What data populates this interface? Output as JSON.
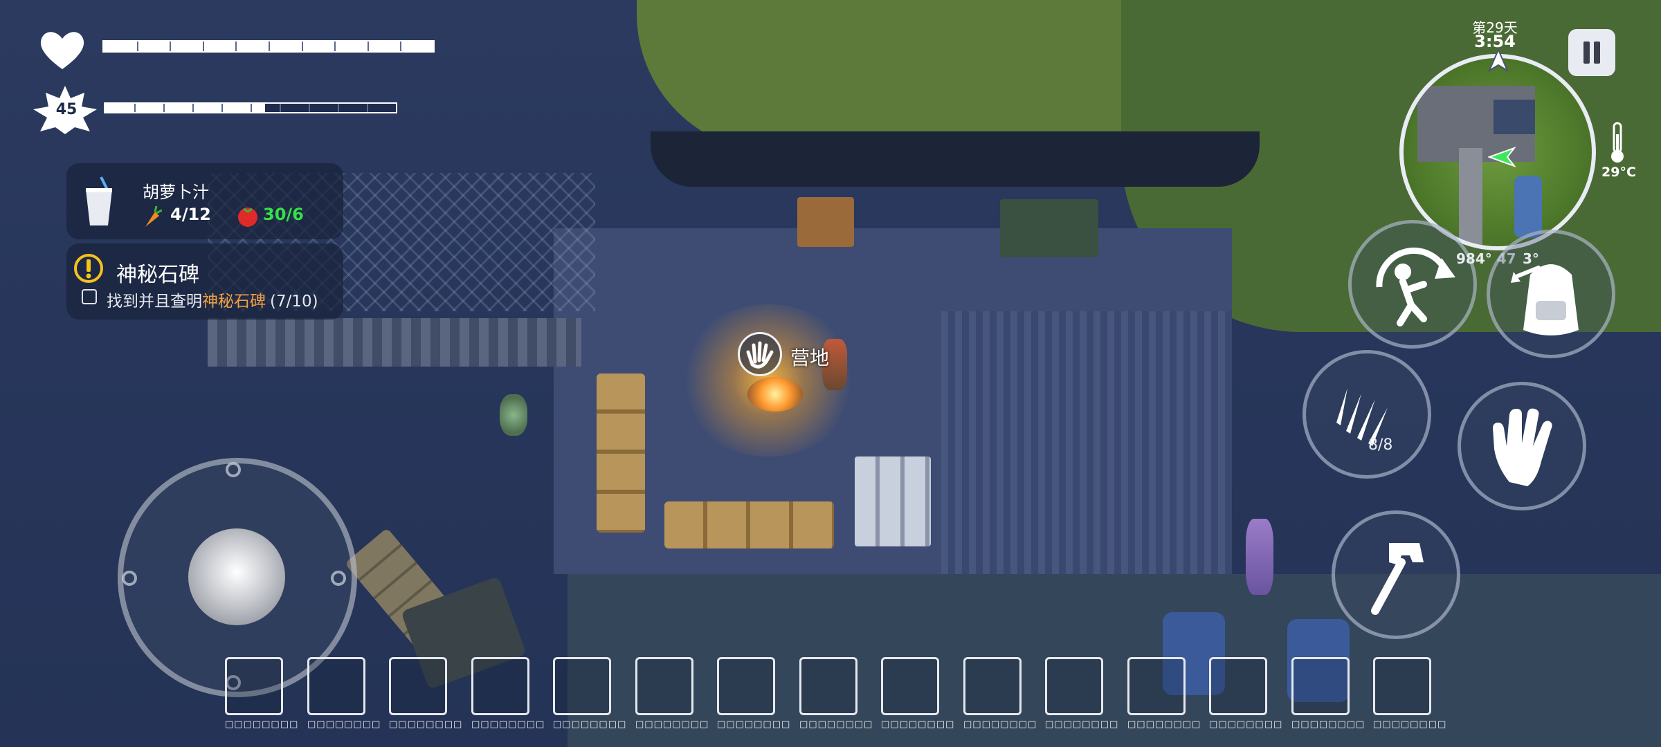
{
  "player": {
    "health_icon": "heart-icon",
    "level": "45",
    "level_icon": "star-badge-icon",
    "health_fraction": 1.0,
    "stamina_fraction": 0.55
  },
  "equipped_item": {
    "name": "胡萝卜汁",
    "icon": "juice-cup-icon",
    "carrot_value": "4/12",
    "carrot_icon": "carrot-icon",
    "tomato_value": "30/6",
    "tomato_icon": "tomato-icon",
    "tomato_color": "#35e04a"
  },
  "quest": {
    "icon": "exclamation-icon",
    "title": "神秘石碑",
    "objective_prefix": "找到并且查明",
    "objective_target": "神秘石碑",
    "objective_count": "(7/10)",
    "target_color": "#f0a040"
  },
  "world": {
    "interaction_icon": "hand-icon",
    "interaction_label": "营地"
  },
  "status": {
    "day": "第29天",
    "time": "3:54",
    "temperature": "29°C",
    "temperature_icon": "thermometer-icon",
    "pause_icon": "pause-icon",
    "compass_icon": "compass-arrow-icon"
  },
  "minimap": {
    "player_marker_icon": "player-arrow-icon"
  },
  "actions": {
    "dodge_icon": "roll-dodge-icon",
    "dodge_coords": "984° 47",
    "backpack_icon": "backpack-icon",
    "backpack_coords": "3°",
    "throw_icon": "throwing-knives-icon",
    "throw_count": "8/8",
    "grab_icon": "hand-icon",
    "attack_icon": "hammer-icon"
  },
  "joystick": {
    "icon": "joystick-knob-icon"
  },
  "hotbar": {
    "slots": [
      {
        "label": "□□□□□□□□"
      },
      {
        "label": "□□□□□□□□"
      },
      {
        "label": "□□□□□□□□"
      },
      {
        "label": "□□□□□□□□"
      },
      {
        "label": "□□□□□□□□"
      },
      {
        "label": "□□□□□□□□"
      },
      {
        "label": "□□□□□□□□"
      },
      {
        "label": "□□□□□□□□"
      },
      {
        "label": "□□□□□□□□"
      },
      {
        "label": "□□□□□□□□"
      },
      {
        "label": "□□□□□□□□"
      },
      {
        "label": "□□□□□□□□"
      },
      {
        "label": "□□□□□□□□"
      },
      {
        "label": "□□□□□□□□"
      },
      {
        "label": "□□□□□□□□"
      }
    ]
  }
}
